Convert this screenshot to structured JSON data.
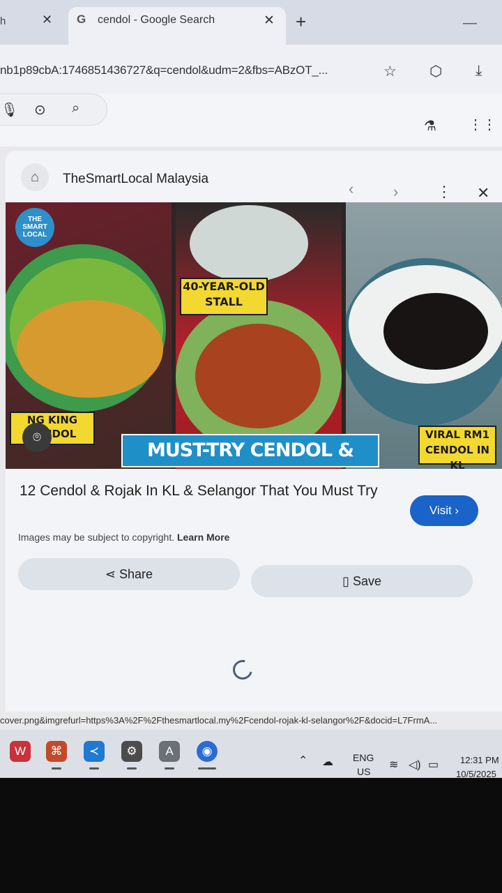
{
  "browser": {
    "prev_tab_title": "h",
    "active_tab": {
      "title": "cendol - Google Search"
    },
    "new_tab_label": "+",
    "url": "nb1p89cbA:1746851436727&q=cendol&udm=2&fbs=ABzOT_..."
  },
  "panel": {
    "source_name": "TheSmartLocal Malaysia",
    "image": {
      "logo_text": "THE SMART LOCAL",
      "sticker_1": "NG KING CENDOL",
      "sticker_2_line1": "40-YEAR-OLD",
      "sticker_2_line2": "STALL",
      "sticker_3_line1": "VIRAL RM1",
      "sticker_3_line2": "CENDOL IN KL",
      "banner": "MUST-TRY CENDOL & ROJAK"
    },
    "title": "12 Cendol & Rojak In KL & Selangor That You Must Try",
    "visit_label": "Visit ›",
    "copyright_text": "Images may be subject to copyright.",
    "learn_more": "Learn More",
    "share_label": "Share",
    "save_label": "Save"
  },
  "status_url": "cover.png&imgrefurl=https%3A%2F%2Fthesmartlocal.my%2Fcendol-rojak-kl-selangor%2F&docid=L7FrmA...",
  "taskbar": {
    "language": "ENG",
    "region": "US",
    "time": "12:31 PM",
    "date": "10/5/2025"
  },
  "colors": {
    "visit_button": "#1a63c8",
    "banner_blue": "#1f8fc8",
    "sticker_yellow": "#f3d82f"
  }
}
